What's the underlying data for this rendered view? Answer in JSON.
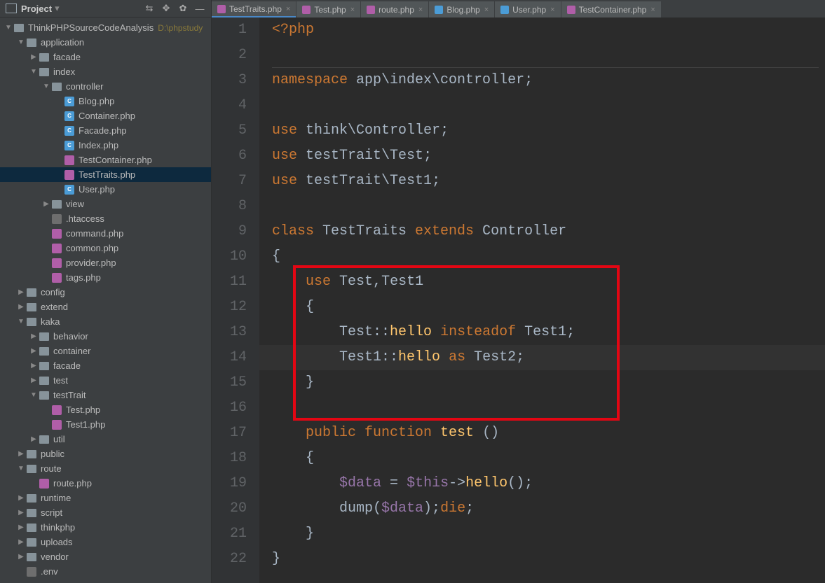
{
  "sidebar": {
    "title": "Project",
    "tree": [
      {
        "depth": 0,
        "arrow": "▼",
        "icon": "folder",
        "iconClass": "root",
        "label": "ThinkPHPSourceCodeAnalysis",
        "hint": "D:\\phpstudy"
      },
      {
        "depth": 1,
        "arrow": "▼",
        "icon": "folder",
        "label": "application"
      },
      {
        "depth": 2,
        "arrow": "▶",
        "icon": "folder",
        "label": "facade"
      },
      {
        "depth": 2,
        "arrow": "▼",
        "icon": "folder",
        "label": "index"
      },
      {
        "depth": 3,
        "arrow": "▼",
        "icon": "folder",
        "label": "controller"
      },
      {
        "depth": 4,
        "arrow": "",
        "icon": "file",
        "iconClass": "php-c",
        "label": "Blog.php"
      },
      {
        "depth": 4,
        "arrow": "",
        "icon": "file",
        "iconClass": "php-c",
        "label": "Container.php"
      },
      {
        "depth": 4,
        "arrow": "",
        "icon": "file",
        "iconClass": "php-c",
        "label": "Facade.php"
      },
      {
        "depth": 4,
        "arrow": "",
        "icon": "file",
        "iconClass": "php-c",
        "label": "Index.php"
      },
      {
        "depth": 4,
        "arrow": "",
        "icon": "file",
        "iconClass": "php-p",
        "label": "TestContainer.php"
      },
      {
        "depth": 4,
        "arrow": "",
        "icon": "file",
        "iconClass": "php-p",
        "label": "TestTraits.php",
        "selected": true
      },
      {
        "depth": 4,
        "arrow": "",
        "icon": "file",
        "iconClass": "php-c",
        "label": "User.php"
      },
      {
        "depth": 3,
        "arrow": "▶",
        "icon": "folder",
        "label": "view"
      },
      {
        "depth": 3,
        "arrow": "",
        "icon": "file",
        "iconClass": "txt",
        "label": ".htaccess"
      },
      {
        "depth": 3,
        "arrow": "",
        "icon": "file",
        "iconClass": "php-p",
        "label": "command.php"
      },
      {
        "depth": 3,
        "arrow": "",
        "icon": "file",
        "iconClass": "php-p",
        "label": "common.php"
      },
      {
        "depth": 3,
        "arrow": "",
        "icon": "file",
        "iconClass": "php-p",
        "label": "provider.php"
      },
      {
        "depth": 3,
        "arrow": "",
        "icon": "file",
        "iconClass": "php-p",
        "label": "tags.php"
      },
      {
        "depth": 1,
        "arrow": "▶",
        "icon": "folder",
        "label": "config"
      },
      {
        "depth": 1,
        "arrow": "▶",
        "icon": "folder",
        "label": "extend"
      },
      {
        "depth": 1,
        "arrow": "▼",
        "icon": "folder",
        "label": "kaka"
      },
      {
        "depth": 2,
        "arrow": "▶",
        "icon": "folder",
        "label": "behavior"
      },
      {
        "depth": 2,
        "arrow": "▶",
        "icon": "folder",
        "label": "container"
      },
      {
        "depth": 2,
        "arrow": "▶",
        "icon": "folder",
        "label": "facade"
      },
      {
        "depth": 2,
        "arrow": "▶",
        "icon": "folder",
        "label": "test"
      },
      {
        "depth": 2,
        "arrow": "▼",
        "icon": "folder",
        "label": "testTrait"
      },
      {
        "depth": 3,
        "arrow": "",
        "icon": "file",
        "iconClass": "php-p",
        "label": "Test.php"
      },
      {
        "depth": 3,
        "arrow": "",
        "icon": "file",
        "iconClass": "php-p",
        "label": "Test1.php"
      },
      {
        "depth": 2,
        "arrow": "▶",
        "icon": "folder",
        "label": "util"
      },
      {
        "depth": 1,
        "arrow": "▶",
        "icon": "folder",
        "label": "public"
      },
      {
        "depth": 1,
        "arrow": "▼",
        "icon": "folder",
        "label": "route"
      },
      {
        "depth": 2,
        "arrow": "",
        "icon": "file",
        "iconClass": "php-p",
        "label": "route.php"
      },
      {
        "depth": 1,
        "arrow": "▶",
        "icon": "folder",
        "label": "runtime"
      },
      {
        "depth": 1,
        "arrow": "▶",
        "icon": "folder",
        "label": "script"
      },
      {
        "depth": 1,
        "arrow": "▶",
        "icon": "folder",
        "label": "thinkphp"
      },
      {
        "depth": 1,
        "arrow": "▶",
        "icon": "folder",
        "label": "uploads"
      },
      {
        "depth": 1,
        "arrow": "▶",
        "icon": "folder",
        "label": "vendor"
      },
      {
        "depth": 1,
        "arrow": "",
        "icon": "file",
        "iconClass": "txt",
        "label": ".env"
      }
    ]
  },
  "tabs": [
    {
      "label": "TestTraits.php",
      "iconClass": "php-p",
      "active": true
    },
    {
      "label": "Test.php",
      "iconClass": "php-p"
    },
    {
      "label": "route.php",
      "iconClass": "php-p"
    },
    {
      "label": "Blog.php",
      "iconClass": "php-c"
    },
    {
      "label": "User.php",
      "iconClass": "php-c"
    },
    {
      "label": "TestContainer.php",
      "iconClass": "php-p"
    }
  ],
  "code": {
    "lines": [
      {
        "n": 1,
        "html": "<span class='tok-kw'>&lt;?php</span>"
      },
      {
        "n": 2,
        "html": ""
      },
      {
        "n": 3,
        "html": "<span class='tok-kw'>namespace </span><span class='tok-ns'>app\\index\\controller;</span>"
      },
      {
        "n": 4,
        "html": ""
      },
      {
        "n": 5,
        "html": "<span class='tok-kw'>use </span><span class='tok-ns'>think\\</span><span class='tok-cls'>Controller</span><span class='tok-punc'>;</span>"
      },
      {
        "n": 6,
        "html": "<span class='tok-kw'>use </span><span class='tok-ns'>testTrait\\</span><span class='tok-cls'>Test</span><span class='tok-punc'>;</span>"
      },
      {
        "n": 7,
        "html": "<span class='tok-kw'>use </span><span class='tok-ns'>testTrait\\</span><span class='tok-cls'>Test1</span><span class='tok-punc'>;</span>"
      },
      {
        "n": 8,
        "html": ""
      },
      {
        "n": 9,
        "html": "<span class='tok-kw'>class </span><span class='tok-cls'>TestTraits </span><span class='tok-kw'>extends </span><span class='tok-cls'>Controller</span>"
      },
      {
        "n": 10,
        "html": "<span class='tok-punc'>{</span>"
      },
      {
        "n": 11,
        "html": "    <span class='tok-kw'>use </span><span class='tok-cls'>Test</span><span class='tok-punc'>,</span><span class='tok-cls'>Test1</span>"
      },
      {
        "n": 12,
        "html": "    <span class='tok-punc'>{</span>"
      },
      {
        "n": 13,
        "html": "        <span class='tok-cls'>Test</span><span class='tok-op'>::</span><span class='tok-mtd'>hello</span> <span class='tok-insteadof'>insteadof</span> <span class='tok-cls'>Test1</span><span class='tok-punc'>;</span>"
      },
      {
        "n": 14,
        "html": "        <span class='tok-cls'>Test1</span><span class='tok-op'>::</span><span class='tok-mtd'>hello</span> <span class='tok-kw'>as</span> <span class='tok-cls'>Test2;</span>",
        "hl": true
      },
      {
        "n": 15,
        "html": "    <span class='tok-punc'>}</span>"
      },
      {
        "n": 16,
        "html": ""
      },
      {
        "n": 17,
        "html": "    <span class='tok-fn-kw'>public function </span><span class='tok-fn'>test </span><span class='tok-punc'>()</span>"
      },
      {
        "n": 18,
        "html": "    <span class='tok-punc'>{</span>"
      },
      {
        "n": 19,
        "html": "        <span class='tok-var'>$data</span> <span class='tok-op'>=</span> <span class='tok-var'>$this</span><span class='tok-op'>-&gt;</span><span class='tok-mtd'>hello</span><span class='tok-punc'>();</span>"
      },
      {
        "n": 20,
        "html": "        <span class='tok-dump'>dump(</span><span class='tok-var'>$data</span><span class='tok-dump'>);</span><span class='tok-kw'>die</span><span class='tok-punc'>;</span>"
      },
      {
        "n": 21,
        "html": "    <span class='tok-punc'>}</span>"
      },
      {
        "n": 22,
        "html": "<span class='tok-punc'>}</span>"
      }
    ]
  }
}
